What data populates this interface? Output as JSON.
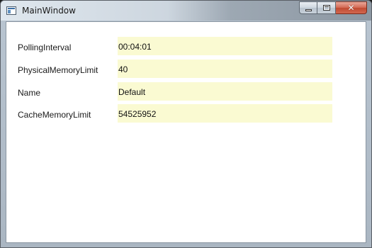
{
  "window": {
    "title": "MainWindow",
    "icon": "window-app-icon",
    "caption_buttons": {
      "minimize_icon": "minimize-icon",
      "maximize_icon": "maximize-icon",
      "close_icon": "close-icon",
      "close_glyph": "✕"
    }
  },
  "form": {
    "fields": [
      {
        "label": "PollingInterval",
        "value": "00:04:01"
      },
      {
        "label": "PhysicalMemoryLimit",
        "value": "40"
      },
      {
        "label": "Name",
        "value": "Default"
      },
      {
        "label": "CacheMemoryLimit",
        "value": "54525952"
      }
    ],
    "field_background": "#fafad2"
  }
}
